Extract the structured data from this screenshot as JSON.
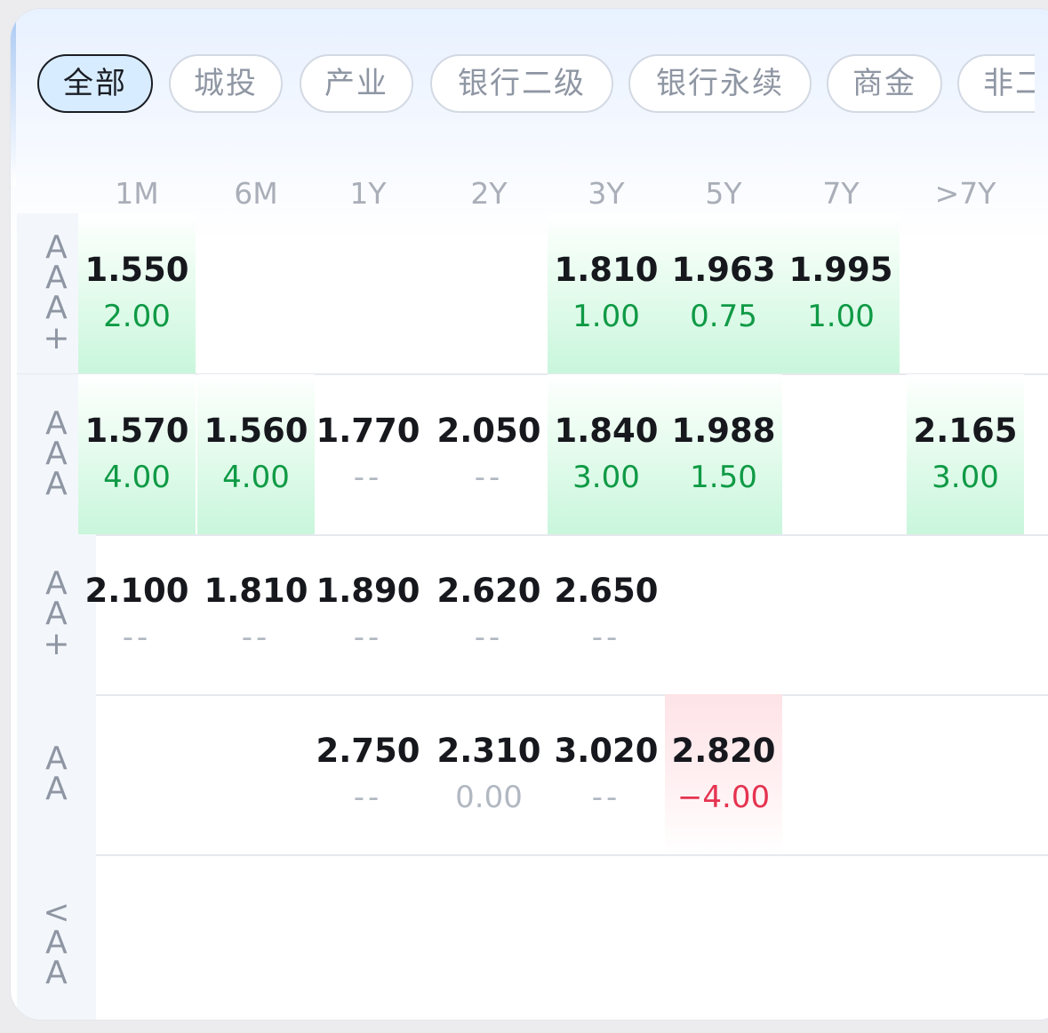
{
  "filters": [
    {
      "label": "全部",
      "active": true
    },
    {
      "label": "城投",
      "active": false
    },
    {
      "label": "产业",
      "active": false
    },
    {
      "label": "银行二级",
      "active": false
    },
    {
      "label": "银行永续",
      "active": false
    },
    {
      "label": "商金",
      "active": false
    },
    {
      "label": "非二",
      "active": false
    }
  ],
  "columns": [
    "1M",
    "6M",
    "1Y",
    "2Y",
    "3Y",
    "5Y",
    "7Y",
    ">7Y"
  ],
  "rows": [
    {
      "rating": "AAA+",
      "chars": [
        "A",
        "A",
        "A",
        "+"
      ],
      "cells": [
        {
          "value": "1.550",
          "change": "2.00",
          "dir": "pos"
        },
        null,
        null,
        null,
        {
          "value": "1.810",
          "change": "1.00",
          "dir": "pos"
        },
        {
          "value": "1.963",
          "change": "0.75",
          "dir": "pos"
        },
        {
          "value": "1.995",
          "change": "1.00",
          "dir": "pos"
        },
        null
      ]
    },
    {
      "rating": "AAA",
      "chars": [
        "A",
        "A",
        "A"
      ],
      "cells": [
        {
          "value": "1.570",
          "change": "4.00",
          "dir": "pos"
        },
        {
          "value": "1.560",
          "change": "4.00",
          "dir": "pos"
        },
        {
          "value": "1.770",
          "change": "--",
          "dir": "none"
        },
        {
          "value": "2.050",
          "change": "--",
          "dir": "none"
        },
        {
          "value": "1.840",
          "change": "3.00",
          "dir": "pos"
        },
        {
          "value": "1.988",
          "change": "1.50",
          "dir": "pos"
        },
        null,
        {
          "value": "2.165",
          "change": "3.00",
          "dir": "pos"
        }
      ]
    },
    {
      "rating": "AA+",
      "chars": [
        "A",
        "A",
        "+"
      ],
      "cells": [
        {
          "value": "2.100",
          "change": "--",
          "dir": "none"
        },
        {
          "value": "1.810",
          "change": "--",
          "dir": "none"
        },
        {
          "value": "1.890",
          "change": "--",
          "dir": "none"
        },
        {
          "value": "2.620",
          "change": "--",
          "dir": "none"
        },
        {
          "value": "2.650",
          "change": "--",
          "dir": "none"
        },
        null,
        null,
        null
      ]
    },
    {
      "rating": "AA",
      "chars": [
        "A",
        "A"
      ],
      "cells": [
        null,
        null,
        {
          "value": "2.750",
          "change": "--",
          "dir": "none"
        },
        {
          "value": "2.310",
          "change": "0.00",
          "dir": "flat"
        },
        {
          "value": "3.020",
          "change": "--",
          "dir": "none"
        },
        {
          "value": "2.820",
          "change": "−4.00",
          "dir": "neg"
        },
        null,
        null
      ]
    },
    {
      "rating": "<AA",
      "chars": [
        "<",
        "A",
        "A"
      ],
      "cells": [
        null,
        null,
        null,
        null,
        null,
        null,
        null,
        null
      ]
    }
  ],
  "colors": {
    "up": "#0f9a45",
    "down": "#e53350",
    "active_tab": "#d8ecff"
  }
}
